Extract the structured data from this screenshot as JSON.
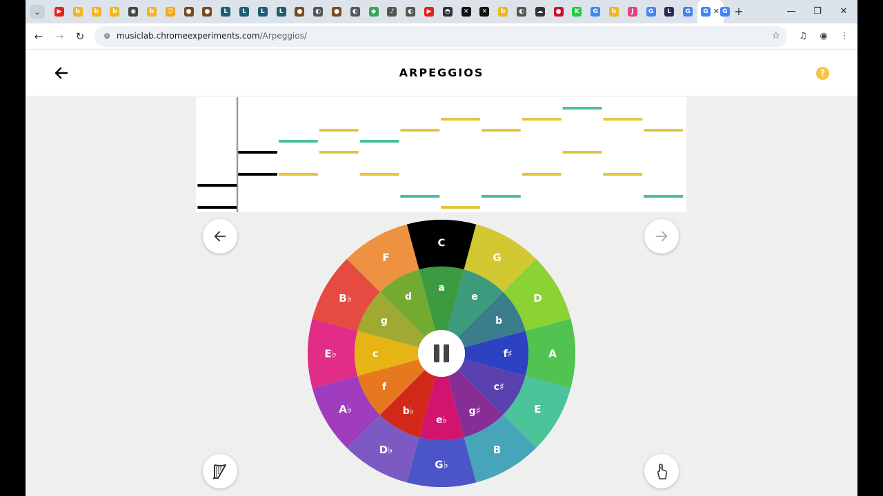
{
  "browser": {
    "tabs": [
      {
        "icon": "youtube-icon",
        "color": "#e62117",
        "glyph": "▶"
      },
      {
        "icon": "bing-icon",
        "color": "#f2b51d",
        "glyph": "b"
      },
      {
        "icon": "bing-icon",
        "color": "#f2b51d",
        "glyph": "b"
      },
      {
        "icon": "bing-icon",
        "color": "#f2b51d",
        "glyph": "b"
      },
      {
        "icon": "chrome-icon",
        "color": "#444444",
        "glyph": "◉"
      },
      {
        "icon": "bing-icon",
        "color": "#f2b51d",
        "glyph": "b"
      },
      {
        "icon": "emoji-icon",
        "color": "#f2a81d",
        "glyph": "☺"
      },
      {
        "icon": "cookie-icon",
        "color": "#7b4a1d",
        "glyph": "●"
      },
      {
        "icon": "cookie-icon",
        "color": "#7b4a1d",
        "glyph": "●"
      },
      {
        "icon": "logo-icon",
        "color": "#1b5e74",
        "glyph": "L"
      },
      {
        "icon": "logo-icon",
        "color": "#1b5e74",
        "glyph": "L"
      },
      {
        "icon": "logo-icon",
        "color": "#1b5e74",
        "glyph": "L"
      },
      {
        "icon": "logo-icon",
        "color": "#1b5e74",
        "glyph": "L"
      },
      {
        "icon": "cookie-icon",
        "color": "#7b4a1d",
        "glyph": "●"
      },
      {
        "icon": "globe-icon",
        "color": "#555555",
        "glyph": "◐"
      },
      {
        "icon": "cookie-icon",
        "color": "#7b4a1d",
        "glyph": "●"
      },
      {
        "icon": "globe-icon",
        "color": "#555555",
        "glyph": "◐"
      },
      {
        "icon": "maps-icon",
        "color": "#34a853",
        "glyph": "◆"
      },
      {
        "icon": "music-icon",
        "color": "#555555",
        "glyph": "♪"
      },
      {
        "icon": "globe-icon",
        "color": "#555555",
        "glyph": "◐"
      },
      {
        "icon": "youtube-icon",
        "color": "#e62117",
        "glyph": "▶"
      },
      {
        "icon": "game-icon",
        "color": "#333333",
        "glyph": "◓"
      },
      {
        "icon": "capcut-icon",
        "color": "#111111",
        "glyph": "✕"
      },
      {
        "icon": "capcut-icon",
        "color": "#111111",
        "glyph": "✕"
      },
      {
        "icon": "bing-icon",
        "color": "#f2b51d",
        "glyph": "b"
      },
      {
        "icon": "globe-icon",
        "color": "#555555",
        "glyph": "◐"
      },
      {
        "icon": "cloud-icon",
        "color": "#333333",
        "glyph": "☁"
      },
      {
        "icon": "record-icon",
        "color": "#d0102a",
        "glyph": "●"
      },
      {
        "icon": "k-icon",
        "color": "#27c93f",
        "glyph": "K"
      },
      {
        "icon": "google-icon",
        "color": "#4285f4",
        "glyph": "G"
      },
      {
        "icon": "bing-icon",
        "color": "#f2b51d",
        "glyph": "b"
      },
      {
        "icon": "jp-icon",
        "color": "#e0458a",
        "glyph": "J"
      },
      {
        "icon": "google-icon",
        "color": "#4285f4",
        "glyph": "G"
      },
      {
        "icon": "lc-icon",
        "color": "#2b2b5a",
        "glyph": "L"
      },
      {
        "icon": "google-icon",
        "color": "#4285f4",
        "glyph": "G"
      },
      {
        "icon": "google-icon",
        "color": "#4285f4",
        "glyph": "G",
        "active": true
      },
      {
        "icon": "google-icon",
        "color": "#4285f4",
        "glyph": "G"
      }
    ],
    "url_domain": "musiclab.chromeexperiments.com",
    "url_path": "/Arpeggios/"
  },
  "app": {
    "title": "ARPEGGIOS",
    "help_label": "?"
  },
  "wheel": {
    "major": [
      {
        "label": "C",
        "color": "#000000"
      },
      {
        "label": "G",
        "color": "#d2c832"
      },
      {
        "label": "D",
        "color": "#8cd232"
      },
      {
        "label": "A",
        "color": "#50c350"
      },
      {
        "label": "E",
        "color": "#4bc39b"
      },
      {
        "label": "B",
        "color": "#46a5b9"
      },
      {
        "label": "G♭",
        "color": "#4b55c8"
      },
      {
        "label": "D♭",
        "color": "#7d5ac3"
      },
      {
        "label": "A♭",
        "color": "#a03cbe"
      },
      {
        "label": "E♭",
        "color": "#e12d87"
      },
      {
        "label": "B♭",
        "color": "#e64b41"
      },
      {
        "label": "F",
        "color": "#ee9141"
      }
    ],
    "minor": [
      {
        "label": "a",
        "color": "#3c9b41"
      },
      {
        "label": "e",
        "color": "#3c9b7d"
      },
      {
        "label": "b",
        "color": "#3c7d8c"
      },
      {
        "label": "f♯",
        "color": "#2d41c3"
      },
      {
        "label": "c♯",
        "color": "#5a41af"
      },
      {
        "label": "g♯",
        "color": "#872d96"
      },
      {
        "label": "e♭",
        "color": "#d2146e"
      },
      {
        "label": "b♭",
        "color": "#d22819"
      },
      {
        "label": "f",
        "color": "#e6781e"
      },
      {
        "label": "c",
        "color": "#e6b414"
      },
      {
        "label": "g",
        "color": "#a0aa32"
      },
      {
        "label": "d",
        "color": "#73aa32"
      }
    ]
  },
  "roll": {
    "notes": [
      {
        "step": -2,
        "row": 2,
        "color": "#000000"
      },
      {
        "step": -2,
        "row": 0,
        "color": "#000000"
      },
      {
        "step": -1,
        "row": 3,
        "color": "#000000"
      },
      {
        "step": -1,
        "row": 5,
        "color": "#000000"
      },
      {
        "step": 0,
        "row": 6,
        "color": "#4bbf9a"
      },
      {
        "step": 0,
        "row": 3,
        "color": "#e3c63c"
      },
      {
        "step": 1,
        "row": 7,
        "color": "#e3c63c"
      },
      {
        "step": 1,
        "row": 5,
        "color": "#e3c63c"
      },
      {
        "step": 2,
        "row": 6,
        "color": "#4bbf9a"
      },
      {
        "step": 2,
        "row": 3,
        "color": "#e3c63c"
      },
      {
        "step": 3,
        "row": 7,
        "color": "#e3c63c"
      },
      {
        "step": 3,
        "row": 1,
        "color": "#4bbf9a"
      },
      {
        "step": 4,
        "row": 8,
        "color": "#e3c63c"
      },
      {
        "step": 4,
        "row": 0,
        "color": "#e3c63c"
      },
      {
        "step": 5,
        "row": 7,
        "color": "#e3c63c"
      },
      {
        "step": 5,
        "row": 1,
        "color": "#4bbf9a"
      },
      {
        "step": 6,
        "row": 8,
        "color": "#e3c63c"
      },
      {
        "step": 6,
        "row": 3,
        "color": "#e3c63c"
      },
      {
        "step": 7,
        "row": 9,
        "color": "#4bbf9a"
      },
      {
        "step": 7,
        "row": 5,
        "color": "#e3c63c"
      },
      {
        "step": 8,
        "row": 8,
        "color": "#e3c63c"
      },
      {
        "step": 8,
        "row": 3,
        "color": "#e3c63c"
      },
      {
        "step": 9,
        "row": 7,
        "color": "#e3c63c"
      },
      {
        "step": 9,
        "row": 1,
        "color": "#4bbf9a"
      }
    ]
  }
}
